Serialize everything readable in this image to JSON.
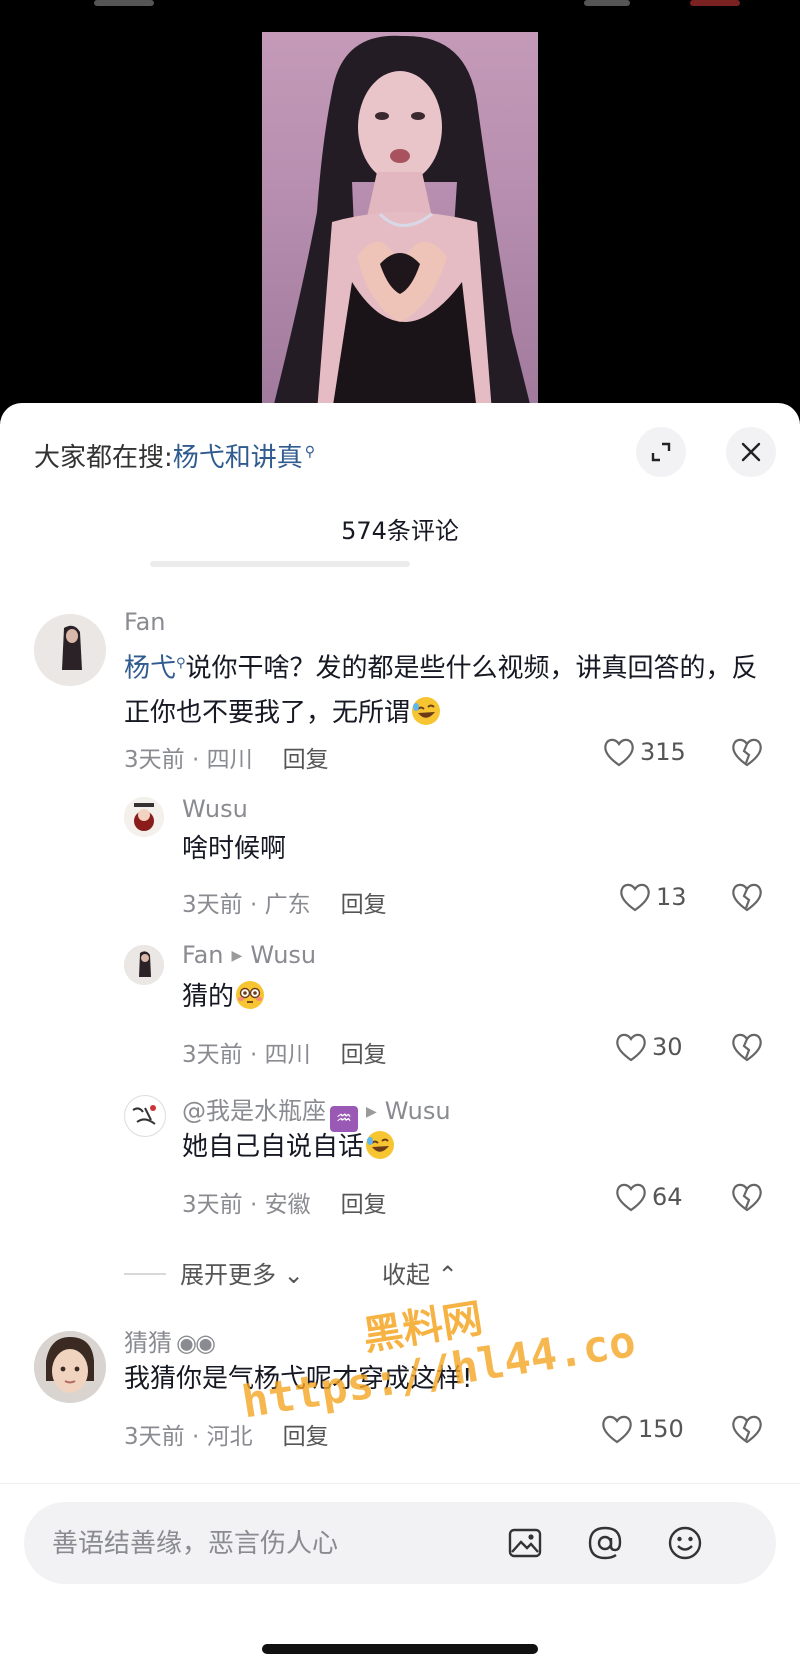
{
  "sheet": {
    "search_prefix": "大家都在搜:",
    "search_term": "杨弋和讲真",
    "comment_count": "574条评论"
  },
  "comments": [
    {
      "username": "Fan",
      "mention": "杨弋",
      "text": "说你干啥？发的都是些什么视频，讲真回答的，反正你也不要我了，无所谓",
      "emoji": "rolling-laughing-emoji",
      "time_location": "3天前 · 四川",
      "reply_label": "回复",
      "likes": "315"
    },
    {
      "username": "Wusu",
      "text": "啥时候啊",
      "time_location": "3天前 · 广东",
      "reply_label": "回复",
      "likes": "13"
    },
    {
      "username": "Fan",
      "reply_to": "Wusu",
      "text": "猜的",
      "emoji": "flushed-face-emoji",
      "time_location": "3天前 · 四川",
      "reply_label": "回复",
      "likes": "30"
    },
    {
      "username": "@我是水瓶座",
      "username_emoji": "aquarius-sign",
      "reply_to": "Wusu",
      "text": "她自己自说自话",
      "emoji": "rolling-laughing-emoji",
      "time_location": "3天前 · 安徽",
      "reply_label": "回复",
      "likes": "64"
    },
    {
      "username": "猜猜",
      "username_emoji": "eyes-emoji",
      "text": "我猜你是气杨弋呢才穿成这样!",
      "time_location": "3天前 · 河北",
      "reply_label": "回复",
      "likes": "150"
    }
  ],
  "thread_controls": {
    "expand_more": "展开更多",
    "collapse": "收起"
  },
  "watermark": {
    "line1": "黑料网",
    "line2": "https://hl44.co"
  },
  "input": {
    "placeholder": "善语结善缘，恶言伤人心"
  },
  "icons": [
    "expand-icon",
    "close-icon",
    "heart-icon",
    "dislike-heart-icon",
    "image-icon",
    "at-icon",
    "emoji-icon"
  ],
  "colors": {
    "mention_blue": "#2f5b8f",
    "meta_gray": "#8a8b91",
    "watermark_orange": "#f5a623"
  }
}
